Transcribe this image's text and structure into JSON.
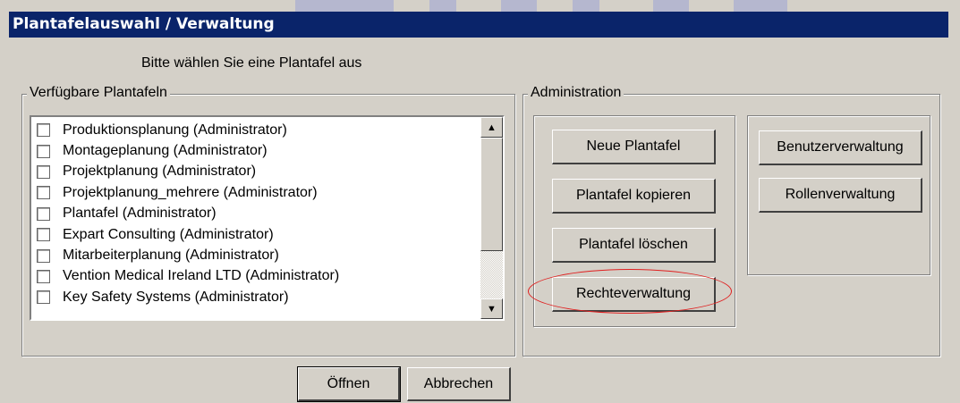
{
  "window": {
    "title": "Plantafelauswahl / Verwaltung"
  },
  "prompt": "Bitte wählen Sie eine Plantafel aus",
  "available": {
    "label": "Verfügbare Plantafeln",
    "items": [
      {
        "label": "Produktionsplanung (Administrator)",
        "checked": false
      },
      {
        "label": "Montageplanung (Administrator)",
        "checked": false
      },
      {
        "label": "Projektplanung (Administrator)",
        "checked": false
      },
      {
        "label": "Projektplanung_mehrere (Administrator)",
        "checked": false
      },
      {
        "label": "Plantafel (Administrator)",
        "checked": false
      },
      {
        "label": "Expart Consulting (Administrator)",
        "checked": false
      },
      {
        "label": "Mitarbeiterplanung (Administrator)",
        "checked": false
      },
      {
        "label": "Vention Medical Ireland LTD (Administrator)",
        "checked": false
      },
      {
        "label": "Key Safety Systems (Administrator)",
        "checked": false
      }
    ]
  },
  "administration": {
    "label": "Administration",
    "buttons": {
      "new": "Neue Plantafel",
      "copy": "Plantafel kopieren",
      "delete": "Plantafel löschen",
      "rights": "Rechteverwaltung",
      "users": "Benutzerverwaltung",
      "roles": "Rollenverwaltung"
    }
  },
  "footer": {
    "open": "Öffnen",
    "cancel": "Abbrechen"
  },
  "colors": {
    "titlebar": "#0a246a",
    "face": "#d4d0c8",
    "highlight_ellipse": "#e02020"
  },
  "icons": {
    "scroll_up": "scroll-up-arrow-icon",
    "scroll_down": "scroll-down-arrow-icon"
  }
}
